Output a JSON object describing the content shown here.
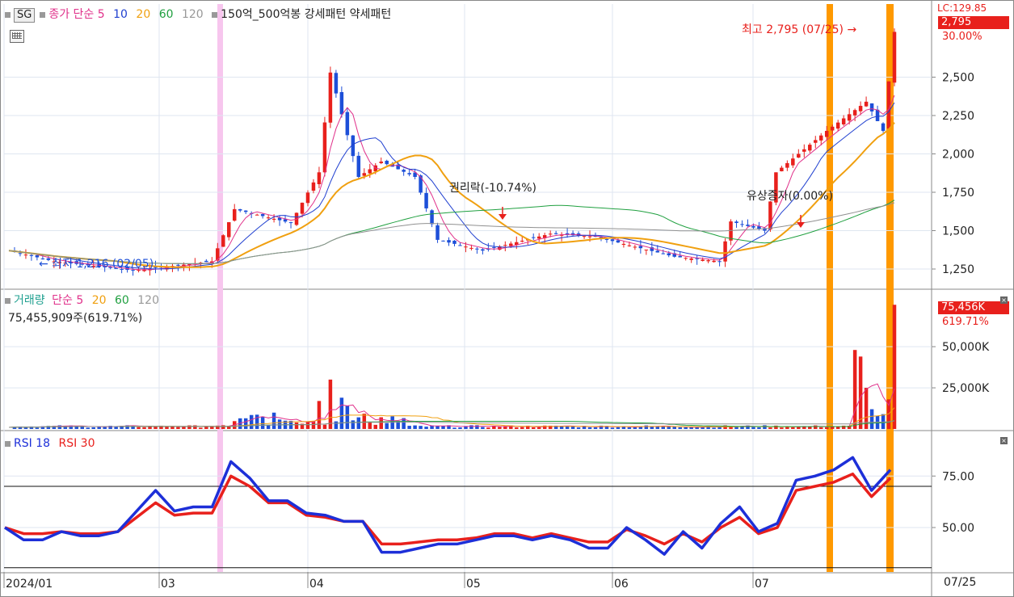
{
  "header": {
    "sg_tag": "SG",
    "price_ind": {
      "label": "종가 단순",
      "p1": "5",
      "p2": "10",
      "p3": "20",
      "p4": "60",
      "p5": "120"
    },
    "bong_label": "150억_500억봉 강세패턴  약세패턴"
  },
  "price_axis": {
    "ticks": [
      "2,500",
      "2,250",
      "2,000",
      "1,750",
      "1,500",
      "1,250"
    ],
    "badge": "2,795",
    "pct_label": "30.00%",
    "lc_label": "LC:129.85"
  },
  "annotations": {
    "high_label": "최고 2,795 (07/25) →",
    "low_label": "← 최저 1,216 (02/05)",
    "ex_rights_label": "권리락(-10.74%)",
    "rights_issue_label": "유상증자(0.00%)"
  },
  "volume_panel": {
    "title": "거래량",
    "ind_label": "단순",
    "p1": "5",
    "p2": "20",
    "p3": "60",
    "p4": "120",
    "value_line": "75,455,909주(619.71%)",
    "badge": "75,456K",
    "pct_label": "619.71%",
    "ticks": [
      "50,000K",
      "25,000K"
    ]
  },
  "rsi_panel": {
    "label1": "RSI 18",
    "label2": "RSI 30",
    "ticks": [
      "75.00",
      "50.00"
    ]
  },
  "x_axis": {
    "labels": [
      "2024/01",
      "03",
      "04",
      "05",
      "06",
      "07"
    ],
    "current_date": "07/25"
  },
  "colors": {
    "up": "#e8201c",
    "down": "#1d4fd8",
    "ma5": "#e0308a",
    "ma10": "#2040d0",
    "ma20": "#f0a010",
    "ma60": "#20a040",
    "ma120": "#909090",
    "highlight": "#ff9900",
    "pink_band": "#f7c6ee"
  },
  "chart_data": [
    {
      "type": "candlestick",
      "title": "",
      "ylim": [
        1150,
        2850
      ],
      "x_range": [
        "2024/01/02",
        "2024/07/25"
      ],
      "ohlc_key_points": [
        {
          "date": "2024/01/02",
          "open": 1390,
          "high": 1400,
          "low": 1350,
          "close": 1370
        },
        {
          "date": "2024/02/05",
          "open": 1260,
          "high": 1280,
          "low": 1216,
          "close": 1240
        },
        {
          "date": "2024/03/05",
          "open": 1470,
          "high": 1680,
          "low": 1460,
          "close": 1640
        },
        {
          "date": "2024/03/19",
          "open": 1550,
          "high": 1890,
          "low": 1530,
          "close": 1880
        },
        {
          "date": "2024/03/22",
          "open": 2350,
          "high": 2550,
          "low": 2300,
          "close": 2530
        },
        {
          "date": "2024/04/08",
          "open": 1520,
          "high": 1570,
          "low": 1420,
          "close": 1440
        },
        {
          "date": "2024/05/10",
          "open": 1460,
          "high": 1520,
          "low": 1440,
          "close": 1480
        },
        {
          "date": "2024/06/05",
          "open": 1420,
          "high": 1520,
          "low": 1400,
          "close": 1500
        },
        {
          "date": "2024/07/03",
          "open": 1420,
          "high": 1620,
          "low": 1380,
          "close": 1560
        },
        {
          "date": "2024/07/15",
          "open": 1480,
          "high": 1510,
          "low": 1460,
          "close": 1500
        },
        {
          "date": "2024/07/17",
          "open": 1510,
          "high": 1900,
          "low": 1500,
          "close": 1880
        },
        {
          "date": "2024/07/24",
          "open": 2320,
          "high": 2440,
          "low": 2150,
          "close": 2150
        },
        {
          "date": "2024/07/25",
          "open": 2150,
          "high": 2795,
          "low": 2140,
          "close": 2795
        }
      ],
      "moving_averages": [
        "5",
        "10",
        "20",
        "60",
        "120"
      ]
    },
    {
      "type": "bar",
      "title": "거래량",
      "ylim": [
        0,
        80000
      ],
      "unit": "K",
      "key_values": [
        {
          "date": "2024/03/22",
          "value": 30000
        },
        {
          "date": "2024/07/17",
          "value": 48000
        },
        {
          "date": "2024/07/18",
          "value": 44000
        },
        {
          "date": "2024/07/19",
          "value": 25000
        },
        {
          "date": "2024/07/25",
          "value": 75456
        }
      ]
    },
    {
      "type": "line",
      "title": "",
      "ylim": [
        30,
        90
      ],
      "reference_line": 70,
      "series": [
        {
          "name": "RSI 18",
          "values": [
            50,
            44,
            44,
            48,
            46,
            46,
            48,
            58,
            68,
            58,
            60,
            60,
            82,
            74,
            63,
            63,
            57,
            56,
            53,
            53,
            38,
            38,
            40,
            42,
            42,
            44,
            46,
            46,
            44,
            46,
            44,
            40,
            40,
            50,
            44,
            37,
            48,
            40,
            52,
            60,
            48,
            52,
            73,
            75,
            78,
            84,
            68,
            78
          ]
        },
        {
          "name": "RSI 30",
          "values": [
            50,
            47,
            47,
            48,
            47,
            47,
            48,
            55,
            62,
            56,
            57,
            57,
            75,
            70,
            62,
            62,
            56,
            55,
            53,
            53,
            42,
            42,
            43,
            44,
            44,
            45,
            47,
            47,
            45,
            47,
            45,
            43,
            43,
            49,
            46,
            42,
            47,
            43,
            50,
            55,
            47,
            50,
            68,
            70,
            72,
            76,
            65,
            74
          ]
        }
      ]
    }
  ]
}
